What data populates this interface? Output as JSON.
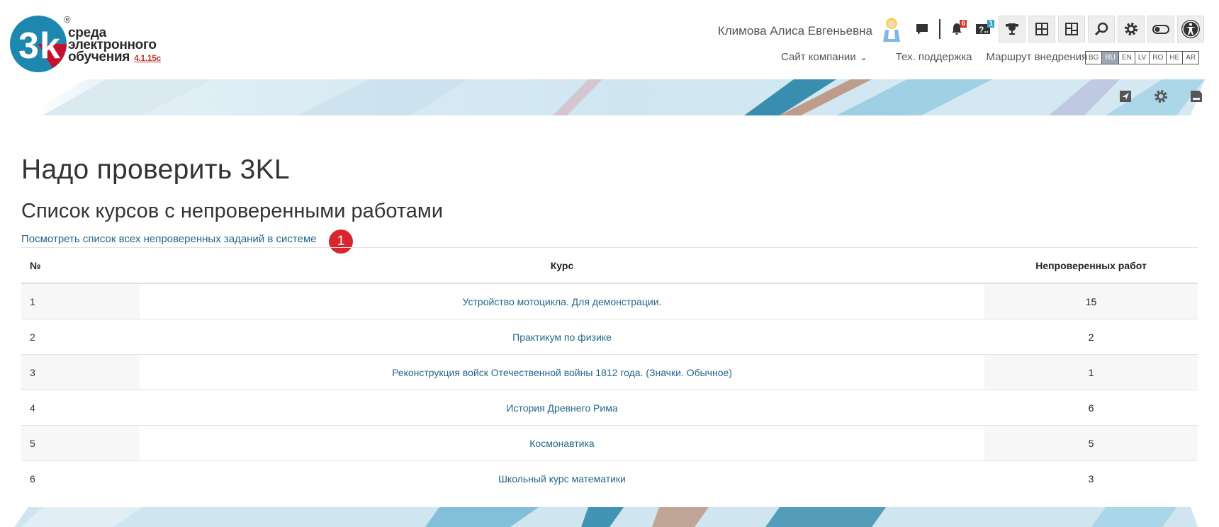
{
  "header": {
    "logo_text_1": "среда",
    "logo_text_2": "электронного",
    "logo_text_3": "обучения",
    "logo_version": "4.1.15c",
    "logo_reg": "®",
    "user_name": "Климова Алиса Евгеньевна",
    "messages_icon": "chat-icon",
    "notifications_badge": "6",
    "questions_badge": "1",
    "nav": {
      "company_site": "Сайт компании",
      "support": "Тех. поддержка",
      "route": "Маршрут внедрения"
    },
    "languages": [
      "BG",
      "RU",
      "EN",
      "LV",
      "RO",
      "HE",
      "AR"
    ],
    "active_language": "RU"
  },
  "main": {
    "page_title": "Надо проверить 3KL",
    "section_title": "Список курсов с непроверенными работами",
    "all_tasks_link": "Посмотреть список всех непроверенных заданий в системе",
    "step_badge": "1",
    "table": {
      "headers": {
        "num": "№",
        "course": "Курс",
        "count": "Непроверенных работ"
      },
      "rows": [
        {
          "num": "1",
          "course": "Устройство мотоцикла. Для демонстрации.",
          "count": "15"
        },
        {
          "num": "2",
          "course": "Практикум по физике",
          "count": "2"
        },
        {
          "num": "3",
          "course": "Реконструкция войск Отечественной войны 1812 года. (Значки. Обычное)",
          "count": "1"
        },
        {
          "num": "4",
          "course": "История Древнего Рима",
          "count": "6"
        },
        {
          "num": "5",
          "course": "Космонавтика",
          "count": "5"
        },
        {
          "num": "6",
          "course": "Школьный курс математики",
          "count": "3"
        }
      ]
    }
  },
  "colors": {
    "link": "#23678a",
    "badge_red": "#d9252e",
    "logo_blue": "#1e87b0",
    "logo_red": "#c8102e"
  }
}
